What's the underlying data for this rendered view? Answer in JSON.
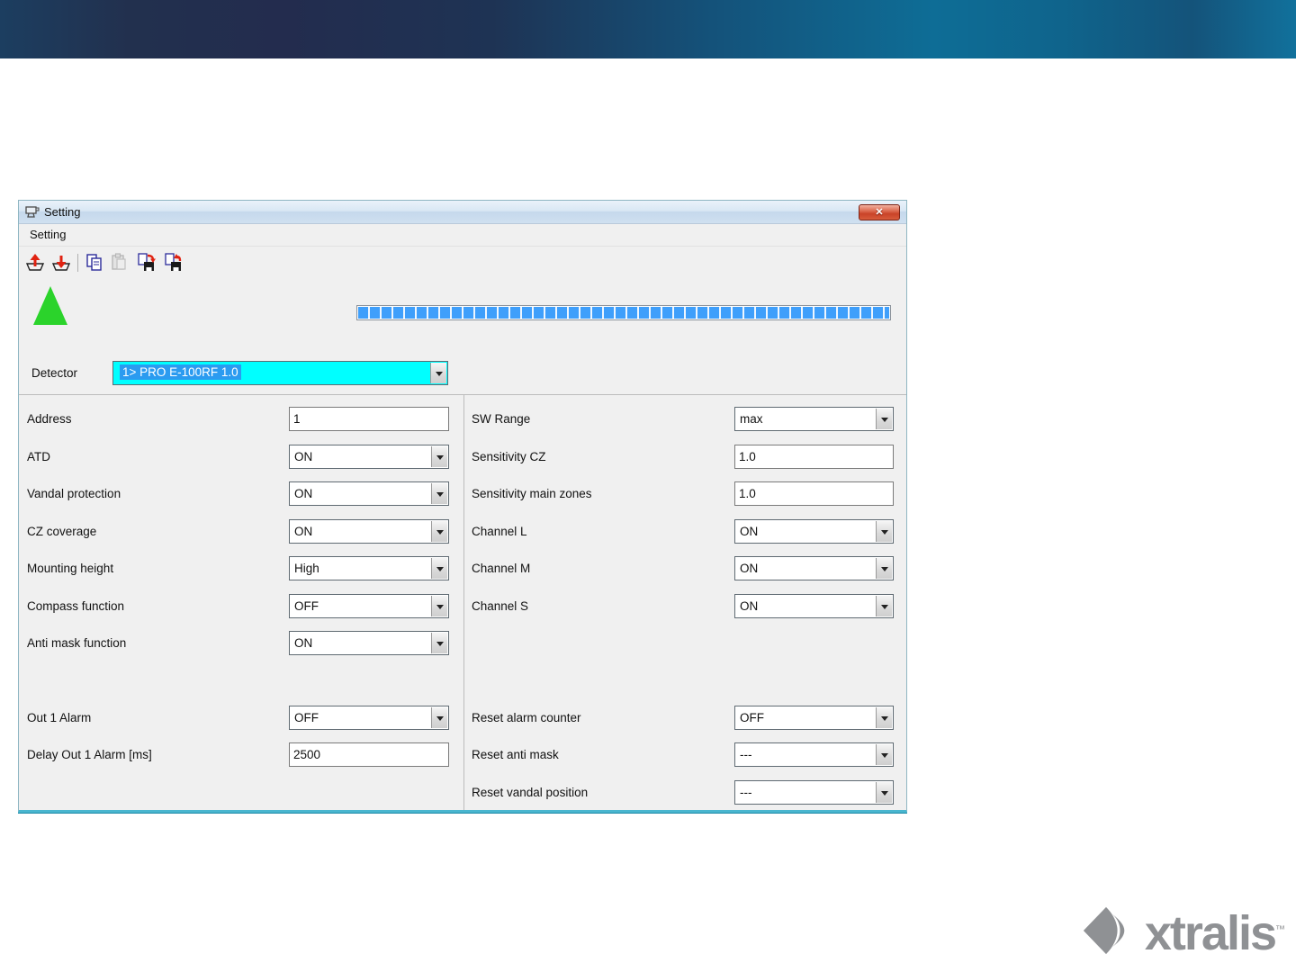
{
  "window": {
    "title": "Setting",
    "menu_label": "Setting",
    "close_glyph": "✕"
  },
  "toolbar": {
    "icons": [
      "upload-icon",
      "download-icon",
      "copy-icon",
      "paste-icon",
      "save-export-icon",
      "save-import-icon"
    ],
    "progress_percent": 100,
    "progress_color": "#3f9ffb"
  },
  "status": {
    "indicator": "green-triangle",
    "indicator_color": "#2bd32b"
  },
  "detector": {
    "label": "Detector",
    "value": "1> PRO E-100RF 1.0",
    "field_bg": "#00ffff",
    "selection_color": "#2b9bf0"
  },
  "form": {
    "left": [
      {
        "label": "Address",
        "type": "input",
        "value": "1"
      },
      {
        "label": "ATD",
        "type": "select",
        "value": "ON"
      },
      {
        "label": "Vandal protection",
        "type": "select",
        "value": "ON"
      },
      {
        "label": "CZ coverage",
        "type": "select",
        "value": "ON"
      },
      {
        "label": "Mounting height",
        "type": "select",
        "value": "High"
      },
      {
        "label": "Compass function",
        "type": "select",
        "value": "OFF"
      },
      {
        "label": "Anti mask function",
        "type": "select",
        "value": "ON"
      },
      {
        "label": "Out 1 Alarm",
        "type": "select",
        "value": "OFF"
      },
      {
        "label": "Delay Out 1 Alarm [ms]",
        "type": "input",
        "value": "2500"
      }
    ],
    "right": [
      {
        "label": "SW Range",
        "type": "select",
        "value": "max"
      },
      {
        "label": "Sensitivity CZ",
        "type": "input",
        "value": "1.0"
      },
      {
        "label": "Sensitivity main zones",
        "type": "input",
        "value": "1.0"
      },
      {
        "label": "Channel L",
        "type": "select",
        "value": "ON"
      },
      {
        "label": "Channel M",
        "type": "select",
        "value": "ON"
      },
      {
        "label": "Channel S",
        "type": "select",
        "value": "ON"
      },
      {
        "label": "Reset alarm counter",
        "type": "select",
        "value": "OFF"
      },
      {
        "label": "Reset anti mask",
        "type": "select",
        "value": "---"
      },
      {
        "label": "Reset vandal position",
        "type": "select",
        "value": "---"
      }
    ]
  },
  "branding": {
    "logo_text": "xtralis",
    "trademark": "™",
    "logo_color": "#8f9194"
  }
}
